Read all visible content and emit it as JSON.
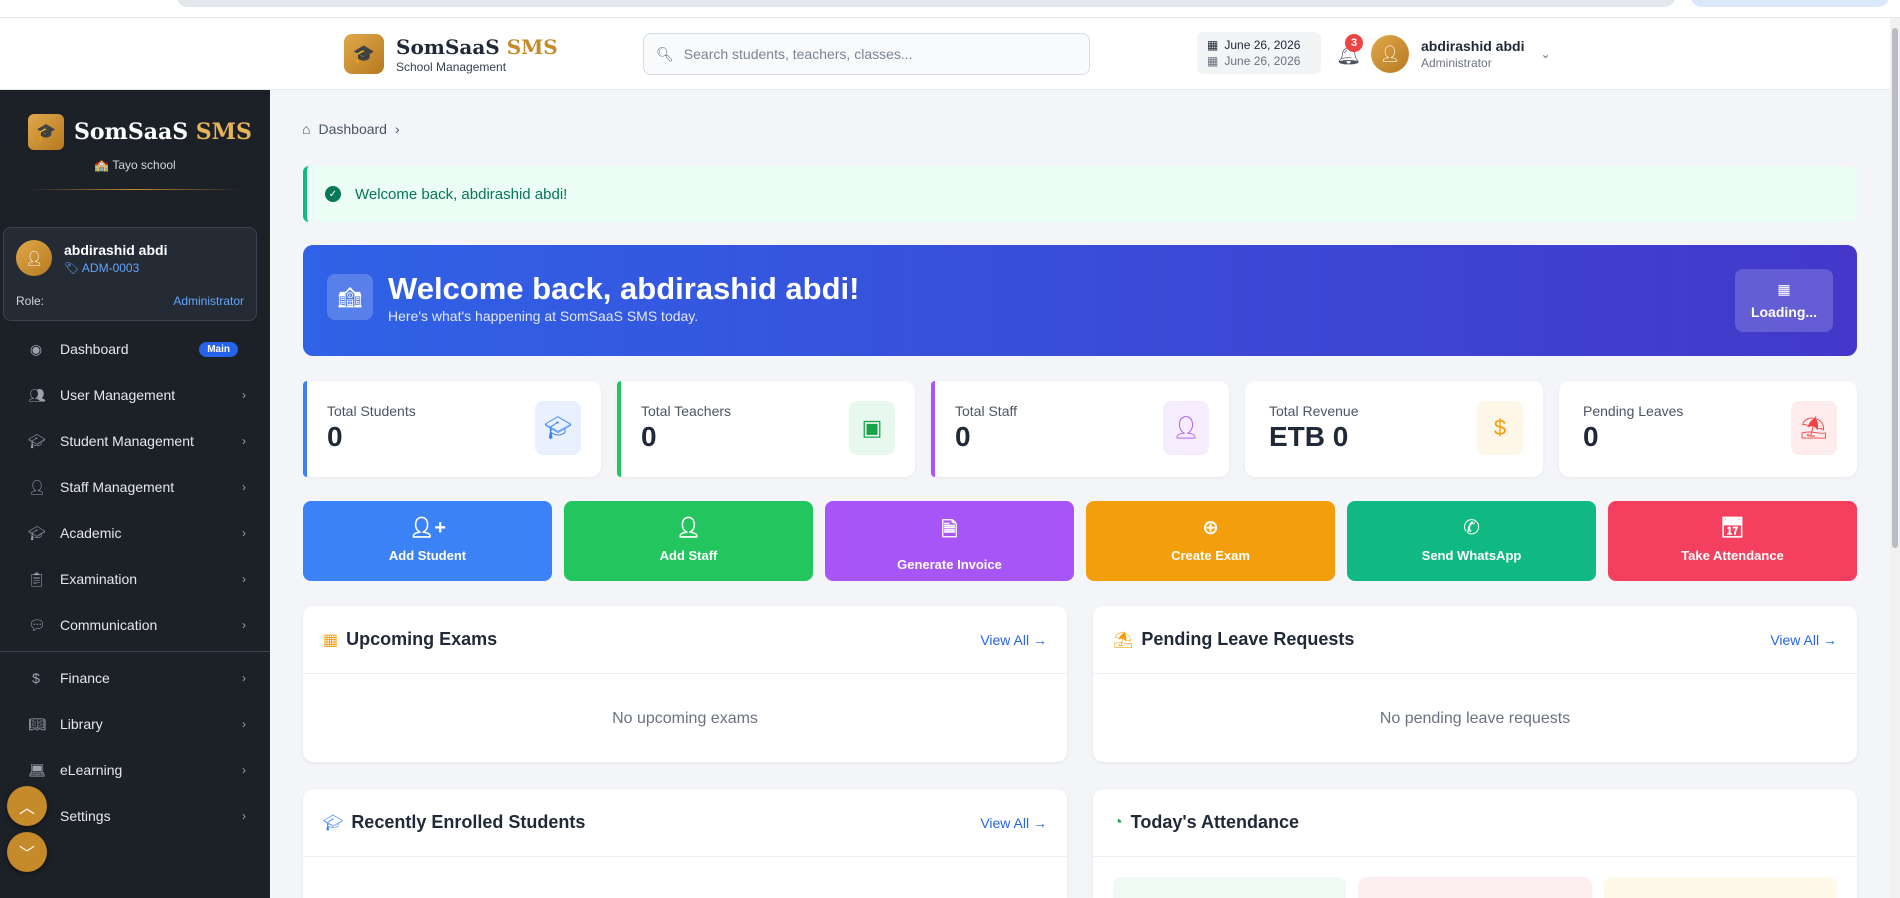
{
  "topbar": {
    "brand_name": "SomSaaS",
    "brand_accent": "SMS",
    "brand_sub": "School Management",
    "search_placeholder": "Search students, teachers, classes...",
    "date_line1": "June 26, 2026",
    "date_line2": "June 26, 2026",
    "notification_count": "3",
    "user_name": "abdirashid abdi",
    "user_role": "Administrator"
  },
  "sidebar": {
    "brand_name": "SomSaaS",
    "brand_accent": "SMS",
    "school": "🏫 Tayo school",
    "card": {
      "name": "abdirashid abdi",
      "id": "ADM-0003",
      "role_label": "Role:",
      "role_value": "Administrator"
    },
    "items": [
      {
        "label": "Dashboard",
        "icon": "palette-icon",
        "badge": "Main"
      },
      {
        "label": "User Management",
        "icon": "users-icon"
      },
      {
        "label": "Student Management",
        "icon": "graduate-icon"
      },
      {
        "label": "Staff Management",
        "icon": "user-tie-icon"
      },
      {
        "label": "Academic",
        "icon": "cap-icon"
      },
      {
        "label": "Examination",
        "icon": "clipboard-icon"
      },
      {
        "label": "Communication",
        "icon": "comments-icon"
      },
      {
        "label": "Finance",
        "icon": "dollar-icon"
      },
      {
        "label": "Library",
        "icon": "book-icon"
      },
      {
        "label": "eLearning",
        "icon": "laptop-icon"
      },
      {
        "label": "Settings",
        "icon": "gear-icon"
      }
    ]
  },
  "main": {
    "breadcrumb": "Dashboard",
    "alert": "Welcome back, abdirashid abdi!",
    "hero": {
      "title": "Welcome back, abdirashid abdi!",
      "subtitle": "Here's what's happening at SomSaaS SMS today.",
      "side_label": "Loading..."
    },
    "stats": [
      {
        "label": "Total Students",
        "value": "0",
        "color": "#3b82f6"
      },
      {
        "label": "Total Teachers",
        "value": "0",
        "color": "#22c55e"
      },
      {
        "label": "Total Staff",
        "value": "0",
        "color": "#a855f7"
      },
      {
        "label": "Total Revenue",
        "value": "ETB 0",
        "color": "#f59e0b"
      },
      {
        "label": "Pending Leaves",
        "value": "0",
        "color": "#ef4444"
      }
    ],
    "actions": [
      {
        "label": "Add Student",
        "color": "#3b82f6"
      },
      {
        "label": "Add Staff",
        "color": "#22c55e"
      },
      {
        "label": "Generate Invoice",
        "color": "#a855f7"
      },
      {
        "label": "Create Exam",
        "color": "#f59e0b"
      },
      {
        "label": "Send WhatsApp",
        "color": "#10b981"
      },
      {
        "label": "Take Attendance",
        "color": "#f43f5e"
      }
    ],
    "panels": {
      "exams": {
        "title": "Upcoming Exams",
        "link": "View All →",
        "empty": "No upcoming exams"
      },
      "leaves": {
        "title": "Pending Leave Requests",
        "link": "View All →",
        "empty": "No pending leave requests"
      },
      "recent": {
        "title": "Recently Enrolled Students",
        "link": "View All →"
      },
      "attendance": {
        "title": "Today's Attendance"
      }
    }
  }
}
